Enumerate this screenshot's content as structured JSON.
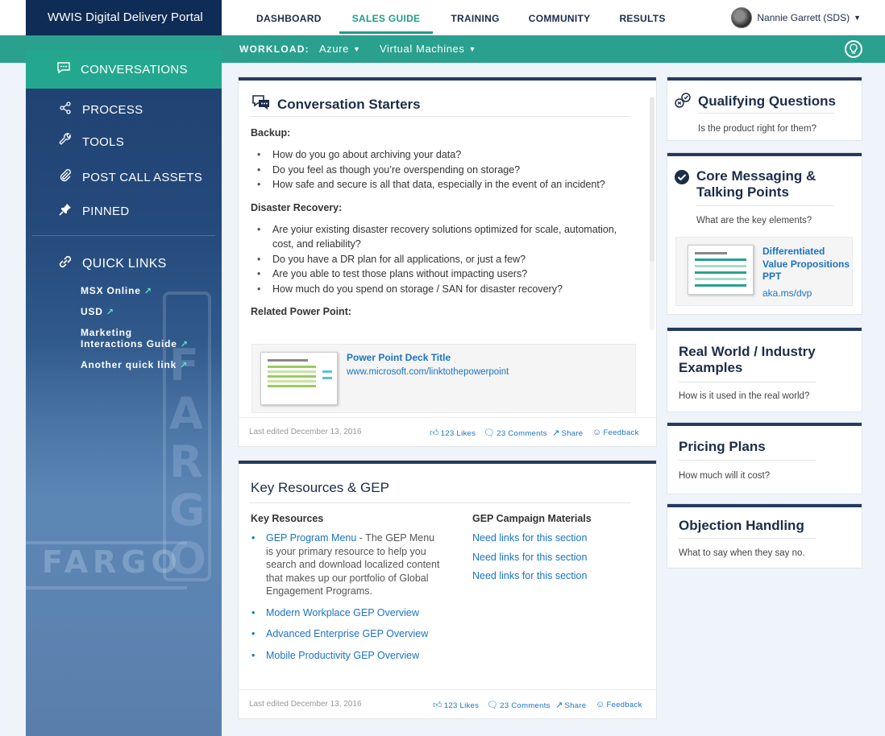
{
  "brand": "WWIS Digital Delivery Portal",
  "top_nav": [
    "DASHBOARD",
    "SALES GUIDE",
    "TRAINING",
    "COMMUNITY",
    "RESULTS"
  ],
  "user": {
    "name": "Nannie Garrett (SDS)"
  },
  "workload": {
    "label": "WORKLOAD:",
    "product": "Azure",
    "category": "Virtual Machines"
  },
  "sidebar": {
    "active": "CONVERSATIONS",
    "items": [
      "PROCESS",
      "TOOLS",
      "POST CALL ASSETS",
      "PINNED"
    ],
    "quick_links_title": "QUICK LINKS",
    "quick_links": [
      "MSX Online",
      "USD",
      "Marketing",
      "Interactions Guide",
      "Another quick link"
    ],
    "background_letters": [
      "FARGO",
      "F",
      "A",
      "R",
      "G",
      "O"
    ]
  },
  "conversation_starters": {
    "title": "Conversation Starters",
    "backup_heading": "Backup:",
    "backup_items": [
      "How do you go about archiving your data?",
      "Do you feel as though you’re overspending on storage?",
      "How safe and secure is all that data, especially in the event of an incident?"
    ],
    "dr_heading": "Disaster Recovery:",
    "dr_items": [
      "Are yoiur existing disaster recovery solutions optimized for scale, automation, cost, and reliability?",
      "Do you have a DR plan for all applications, or just a few?",
      "Are you able to test those plans without impacting users?",
      "How much do you spend on storage / SAN for disaster recovery?"
    ],
    "related_heading": "Related Power Point:",
    "ppt_title": "Power Point Deck Title",
    "ppt_url": "www.microsoft.com/linktothepowerpoint",
    "footer": {
      "edited": "Last edited December 13, 2016",
      "likes": "123 Likes",
      "comments": "23 Comments",
      "share": "Share",
      "feedback": "Feedback"
    }
  },
  "key_resources": {
    "title": "Key Resources & GEP",
    "left_heading": "Key Resources",
    "gep_link": "GEP Program Menu",
    "gep_desc": " - The GEP Menu is your primary resource to help you search and download localized content that makes up our portfolio of Global Engagement Programs.",
    "links": [
      "Modern Workplace GEP Overview",
      "Advanced Enterprise GEP Overview",
      "Mobile Productivity GEP Overview"
    ],
    "right_heading": "GEP Campaign Materials",
    "right_links": [
      "Need links for this section",
      "Need links for this section",
      "Need links for this section"
    ],
    "footer": {
      "edited": "Last edited December 13, 2016",
      "likes": "123 Likes",
      "comments": "23 Comments",
      "share": "Share",
      "feedback": "Feedback"
    }
  },
  "right_cards": {
    "qualifying": {
      "title": "Qualifying Questions",
      "sub": "Is the product right for them?"
    },
    "core": {
      "title_line1": "Core Messaging &",
      "title_line2": "Talking Points",
      "sub": "What are the key elements?",
      "dvp_line1": "Differentiated",
      "dvp_line2": "Value Propositions",
      "dvp_line3": "PPT",
      "dvp_url": "aka.ms/dvp"
    },
    "real_world": {
      "title_line1": "Real World / Industry",
      "title_line2": "Examples",
      "sub": "How is it used in the real world?"
    },
    "pricing": {
      "title": "Pricing Plans",
      "sub": "How much will it cost?"
    },
    "objection": {
      "title": "Objection Handling",
      "sub": "What to say when they say no."
    }
  },
  "colors": {
    "navy": "#0f2c57",
    "teal": "#2aa08f",
    "accent": "#23a88f",
    "link": "#1a73c4"
  }
}
